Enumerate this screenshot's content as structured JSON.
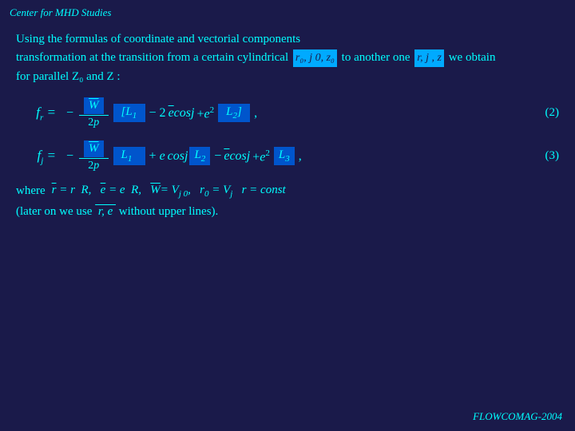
{
  "header": {
    "title": "Center for MHD Studies"
  },
  "intro": {
    "line1": "Using the formulas of coordinate and vectorial components",
    "line2_part1": "transformation at the transition from a certain cylindrical",
    "line2_coord_label": "r₀, j 0, z₀",
    "line2_part2": "to another one",
    "line2_coord2_label": "r, j , z",
    "line2_part3": "we obtain",
    "line3": "for parallel Z₀ and Z :"
  },
  "equations": {
    "eq2_label": "fᵣ =",
    "eq2_number": "(2)",
    "eq3_label": "fⱼ =",
    "eq3_number": "(3)"
  },
  "where_section": {
    "label": "where",
    "relations": "r̅ = r  R,   e̅ = e  R,   W̅= Vⱼ₀,   r₀ = Vⱼ   r = const"
  },
  "later_section": {
    "text_before": "(later on we use",
    "vars": "r, e",
    "text_after": "without upper lines)."
  },
  "footer": {
    "text": "FLOWCOMAG-2004"
  }
}
